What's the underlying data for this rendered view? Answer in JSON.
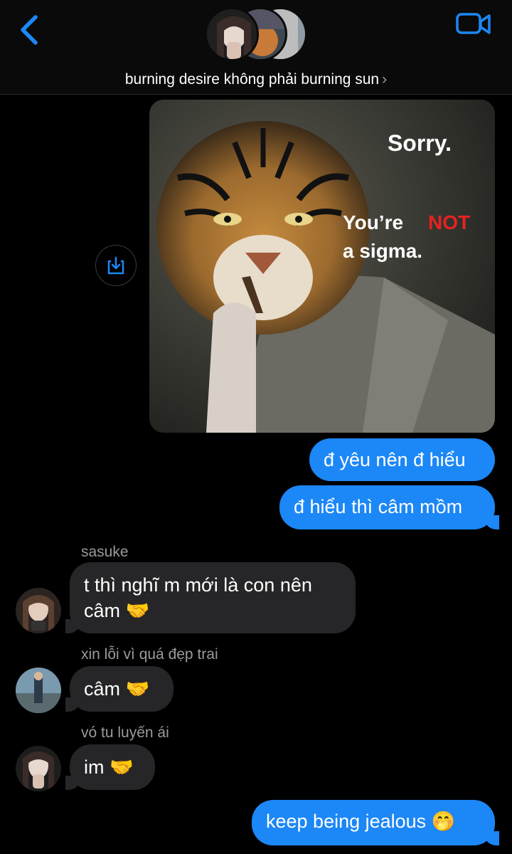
{
  "header": {
    "title": "burning desire không phải burning sun",
    "chevron": "›",
    "accent": "#1c87f6"
  },
  "media": {
    "text_sorry": "Sorry.",
    "text_youre": "You’re",
    "text_not": "NOT",
    "text_sigma": "a sigma."
  },
  "messages": [
    {
      "type": "sent",
      "text": "đ yêu nên đ hiểu"
    },
    {
      "type": "sent",
      "text": "đ hiểu thì câm mồm"
    },
    {
      "type": "received",
      "sender": "sasuke",
      "text": "t thì nghĩ m mới là con nên câm 🤝"
    },
    {
      "type": "received",
      "sender": "xin lỗi vì quá đẹp trai",
      "text": "câm 🤝"
    },
    {
      "type": "received",
      "sender": "vó tu luyến ái",
      "text": "im 🤝"
    },
    {
      "type": "sent",
      "text": "keep being jealous 🤭"
    }
  ],
  "icons": {
    "back": "chevron-left-icon",
    "video": "video-camera-icon",
    "save": "download-icon"
  }
}
